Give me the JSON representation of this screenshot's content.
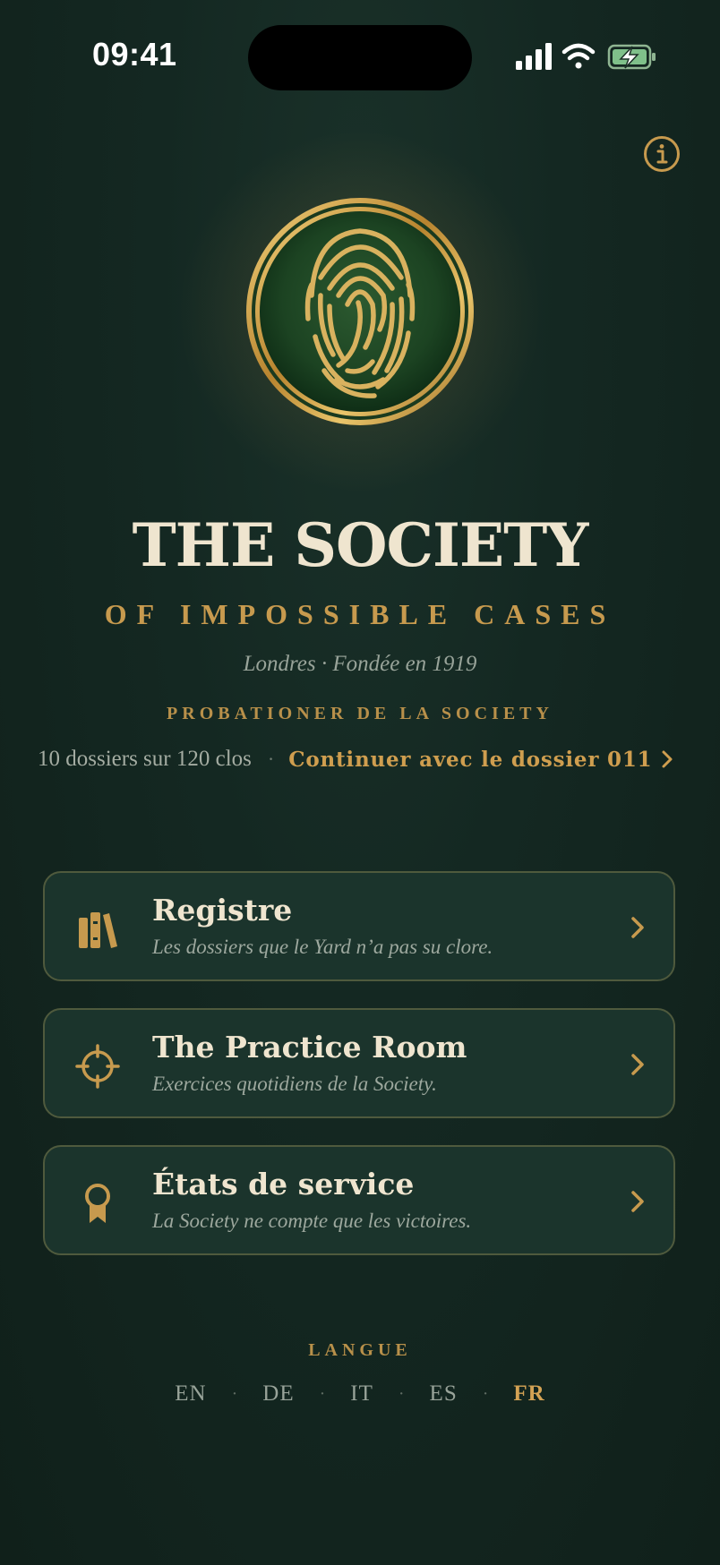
{
  "status_bar": {
    "time": "09:41"
  },
  "colors": {
    "background": "#132620",
    "accent_gold": "#c79a4e",
    "card_bg": "#1b342c",
    "card_border": "#4f5a3d",
    "text_cream": "#efe5cf"
  },
  "header": {
    "info_icon": "info-circle-icon",
    "emblem_icon": "fingerprint-icon"
  },
  "hero": {
    "title": "THE SOCIETY",
    "subtitle": "OF IMPOSSIBLE CASES",
    "place": "Londres · Fondée en 1919",
    "rank": "PROBATIONER DE LA SOCIETY",
    "progress": "10 dossiers sur 120 clos",
    "separator": "·",
    "continue_label": "Continuer avec le dossier 011"
  },
  "menu": [
    {
      "title": "Registre",
      "description": "Les dossiers que le Yard n’a pas su clore.",
      "icon": "books-icon"
    },
    {
      "title": "The Practice Room",
      "description": "Exercices quotidiens de la Society.",
      "icon": "crosshair-icon"
    },
    {
      "title": "États de service",
      "description": "La Society ne compte que les victoires.",
      "icon": "award-ribbon-icon"
    }
  ],
  "language": {
    "label": "LANGUE",
    "options": [
      "EN",
      "DE",
      "IT",
      "ES",
      "FR"
    ],
    "selected": "FR",
    "separator": "·"
  }
}
